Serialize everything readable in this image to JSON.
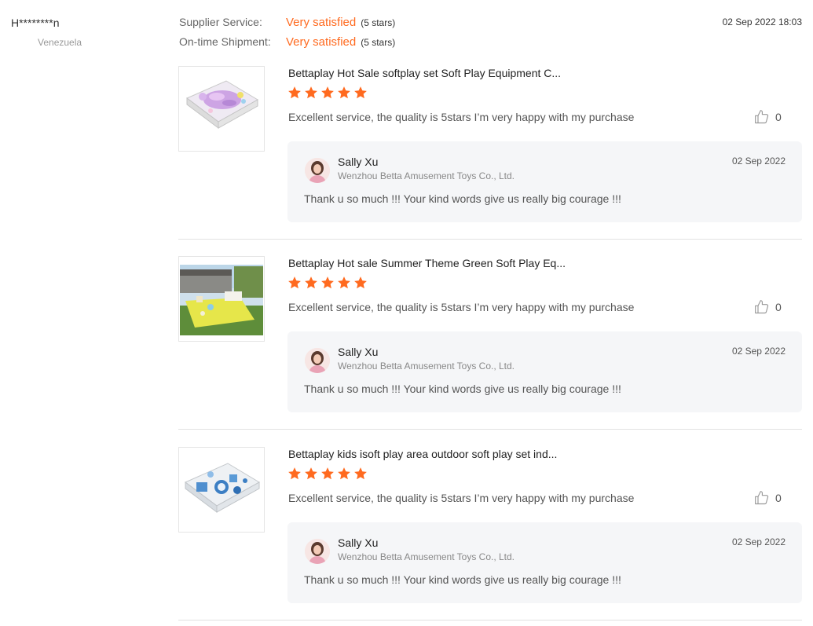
{
  "buyer": {
    "name": "H********n",
    "country": "Venezuela"
  },
  "ratings": [
    {
      "label": "Supplier Service:",
      "value": "Very satisfied",
      "stars_text": "(5 stars)"
    },
    {
      "label": "On-time Shipment:",
      "value": "Very satisfied",
      "stars_text": "(5 stars)"
    }
  ],
  "review_date": "02 Sep 2022 18:03",
  "colors": {
    "accent": "#ff6a1f",
    "star": "#ff6a1f",
    "reply_bg": "#f5f6f8"
  },
  "icons": {
    "star": "star-icon",
    "like": "thumbs-up-icon"
  },
  "reviews": [
    {
      "product_title": "Bettaplay Hot Sale softplay set Soft Play Equipment C...",
      "rating": 5,
      "text": "Excellent service, the quality is 5stars I’m very happy with my purchase",
      "likes": "0",
      "reply": {
        "name": "Sally Xu",
        "company": "Wenzhou Betta Amusement Toys Co., Ltd.",
        "date": "02 Sep 2022",
        "text": "Thank u so much !!! Your kind words give us really big courage !!!"
      }
    },
    {
      "product_title": "Bettaplay Hot sale Summer Theme Green Soft Play Eq...",
      "rating": 5,
      "text": "Excellent service, the quality is 5stars I’m very happy with my purchase",
      "likes": "0",
      "reply": {
        "name": "Sally Xu",
        "company": "Wenzhou Betta Amusement Toys Co., Ltd.",
        "date": "02 Sep 2022",
        "text": "Thank u so much !!! Your kind words give us really big courage !!!"
      }
    },
    {
      "product_title": "Bettaplay kids isoft play area outdoor soft play set ind...",
      "rating": 5,
      "text": "Excellent service, the quality is 5stars I’m very happy with my purchase",
      "likes": "0",
      "reply": {
        "name": "Sally Xu",
        "company": "Wenzhou Betta Amusement Toys Co., Ltd.",
        "date": "02 Sep 2022",
        "text": "Thank u so much !!! Your kind words give us really big courage !!!"
      }
    }
  ]
}
